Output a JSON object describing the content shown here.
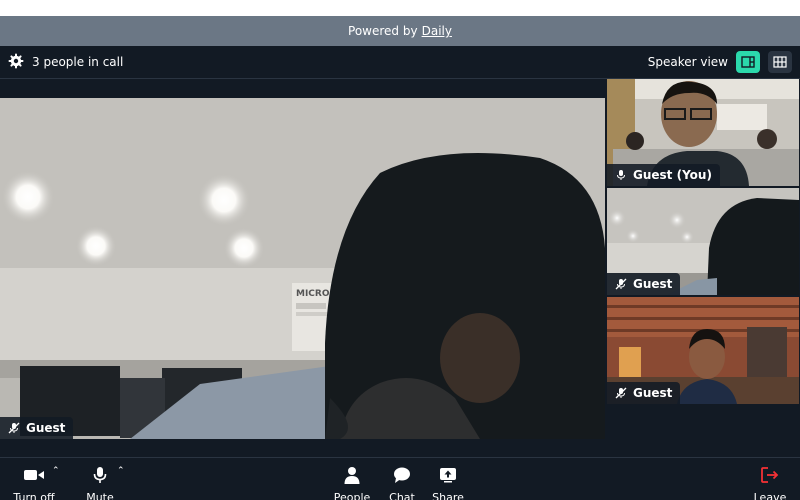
{
  "banner": {
    "prefix": "Powered by",
    "link": "Daily"
  },
  "topbar": {
    "people_count": "3 people in call",
    "view_label": "Speaker view"
  },
  "main_tile": {
    "name": "Guest",
    "wall_sign": "MICROPO"
  },
  "side_tiles": [
    {
      "name": "Guest (You)",
      "mic": "on"
    },
    {
      "name": "Guest",
      "mic": "muted"
    },
    {
      "name": "Guest",
      "mic": "muted"
    }
  ],
  "controls": {
    "camera": "Turn off",
    "mic": "Mute",
    "people": "People",
    "chat": "Chat",
    "share": "Share",
    "leave": "Leave"
  },
  "colors": {
    "accent": "#2bd9ac",
    "leave": "#f63135",
    "background": "#121a24",
    "banner": "#6b7785"
  }
}
